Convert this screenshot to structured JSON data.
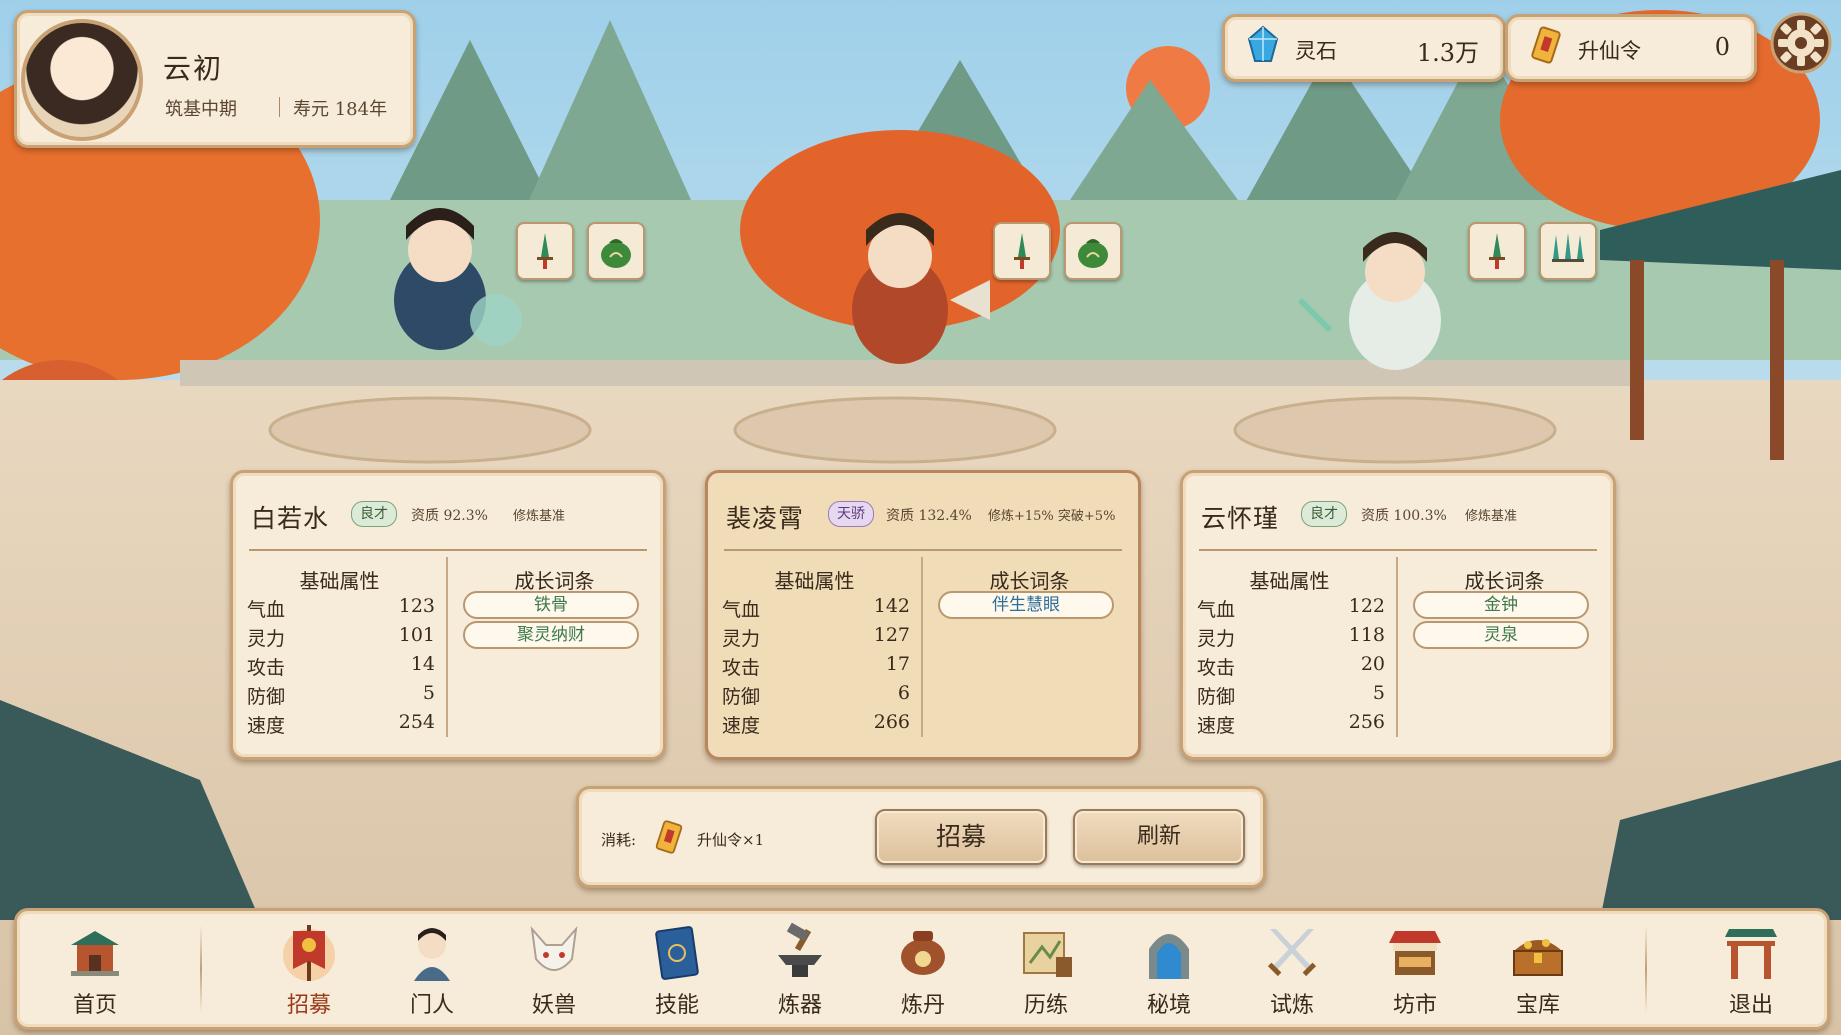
{
  "player": {
    "name": "云初",
    "realm": "筑基中期",
    "lifespan": "寿元 184年"
  },
  "currencies": [
    {
      "icon": "spirit-stone-icon",
      "label": "灵石",
      "value": "1.3万"
    },
    {
      "icon": "ascension-token-icon",
      "label": "升仙令",
      "value": "0"
    }
  ],
  "candidates": [
    {
      "name": "白若水",
      "grade": "良才",
      "aptitude": "资质 92.3%",
      "bonus": "修炼基准",
      "base_title": "基础属性",
      "growth_title": "成长词条",
      "stats": [
        {
          "k": "气血",
          "v": "123"
        },
        {
          "k": "灵力",
          "v": "101"
        },
        {
          "k": "攻击",
          "v": "14"
        },
        {
          "k": "防御",
          "v": "5"
        },
        {
          "k": "速度",
          "v": "254"
        }
      ],
      "traits": [
        "铁骨",
        "聚灵纳财"
      ]
    },
    {
      "name": "裴凌霄",
      "grade": "天骄",
      "aptitude": "资质 132.4%",
      "bonus": "修炼+15% 突破+5%",
      "base_title": "基础属性",
      "growth_title": "成长词条",
      "stats": [
        {
          "k": "气血",
          "v": "142"
        },
        {
          "k": "灵力",
          "v": "127"
        },
        {
          "k": "攻击",
          "v": "17"
        },
        {
          "k": "防御",
          "v": "6"
        },
        {
          "k": "速度",
          "v": "266"
        }
      ],
      "traits": [
        "伴生慧眼"
      ]
    },
    {
      "name": "云怀瑾",
      "grade": "良才",
      "aptitude": "资质 100.3%",
      "bonus": "修炼基准",
      "base_title": "基础属性",
      "growth_title": "成长词条",
      "stats": [
        {
          "k": "气血",
          "v": "122"
        },
        {
          "k": "灵力",
          "v": "118"
        },
        {
          "k": "攻击",
          "v": "20"
        },
        {
          "k": "防御",
          "v": "5"
        },
        {
          "k": "速度",
          "v": "256"
        }
      ],
      "traits": [
        "金钟",
        "灵泉"
      ]
    }
  ],
  "recruit": {
    "cost_label": "消耗:",
    "cost_item": "升仙令×1",
    "recruit_label": "招募",
    "refresh_label": "刷新"
  },
  "nav": [
    {
      "label": "首页",
      "icon": "pavilion-icon"
    },
    {
      "label": "招募",
      "icon": "banner-icon",
      "active": true
    },
    {
      "label": "门人",
      "icon": "disciple-icon"
    },
    {
      "label": "妖兽",
      "icon": "fox-icon"
    },
    {
      "label": "技能",
      "icon": "skill-book-icon"
    },
    {
      "label": "炼器",
      "icon": "anvil-icon"
    },
    {
      "label": "炼丹",
      "icon": "cauldron-icon"
    },
    {
      "label": "历练",
      "icon": "scroll-map-icon"
    },
    {
      "label": "秘境",
      "icon": "portal-icon"
    },
    {
      "label": "试炼",
      "icon": "crossed-swords-icon"
    },
    {
      "label": "坊市",
      "icon": "market-stall-icon"
    },
    {
      "label": "宝库",
      "icon": "treasure-chest-icon"
    },
    {
      "label": "退出",
      "icon": "gate-icon"
    }
  ],
  "colors": {
    "accent": "#9a3a1a",
    "panel": "#f7ecd9",
    "border": "#c8a274",
    "good": "#3b5e37",
    "elite": "#5a3a7a"
  }
}
